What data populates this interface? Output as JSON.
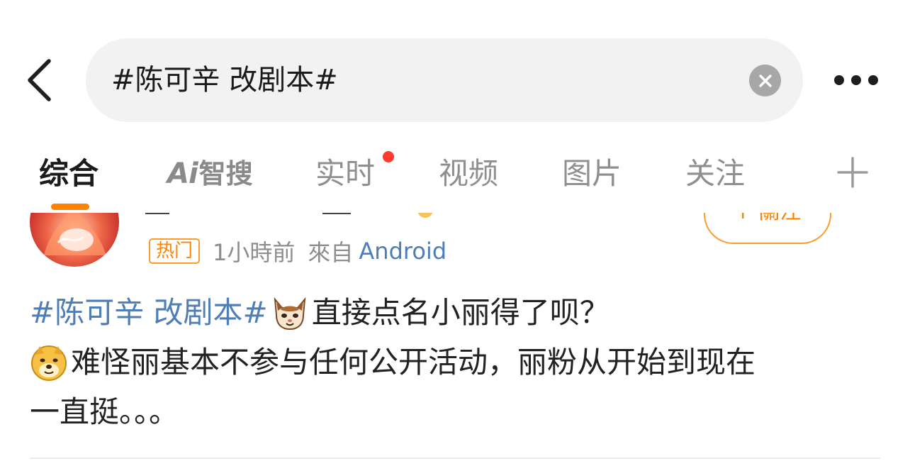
{
  "search": {
    "query": "#陈可辛 改剧本#"
  },
  "tabs": [
    {
      "label": "综合",
      "active": true
    },
    {
      "label": "智搜",
      "prefix": "Ai"
    },
    {
      "label": "实时",
      "badge": "red-dot"
    },
    {
      "label": "视频"
    },
    {
      "label": "图片"
    },
    {
      "label": "关注"
    }
  ],
  "post": {
    "follow_label": "+ 關注",
    "hot_badge": "热门",
    "time": "1小時前",
    "source_prefix": "來自",
    "device": "Android",
    "hashtag": "#陈可辛 改剧本#",
    "line1_text": "直接点名小丽得了呗？",
    "line2_text": "难怪丽基本不参与任何公开活动，丽粉从开始到现在",
    "line3_text": "一直挺。。。",
    "emojis": [
      "cat-emoji",
      "doge-emoji"
    ]
  },
  "colors": {
    "accent_orange": "#ff8200",
    "link_blue": "#4f7db5",
    "notification_red": "#ff3b30"
  },
  "icons": [
    "back-arrow-icon",
    "clear-icon",
    "more-icon",
    "plus-icon"
  ]
}
